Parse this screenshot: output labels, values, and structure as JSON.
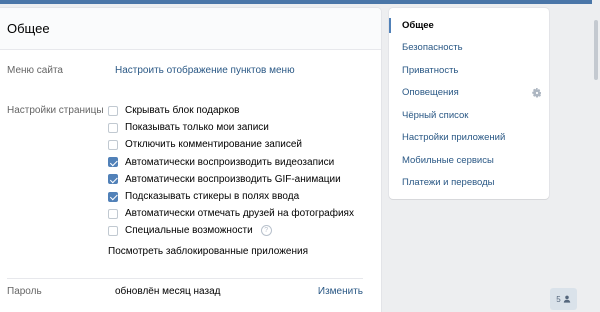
{
  "main": {
    "title": "Общее",
    "menu_row": {
      "label": "Меню сайта",
      "link": "Настроить отображение пунктов меню"
    },
    "page_settings": {
      "label": "Настройки страницы",
      "options": [
        {
          "label": "Скрывать блок подарков",
          "checked": false
        },
        {
          "label": "Показывать только мои записи",
          "checked": false
        },
        {
          "label": "Отключить комментирование записей",
          "checked": false
        },
        {
          "label": "Автоматически воспроизводить видеозаписи",
          "checked": true
        },
        {
          "label": "Автоматически воспроизводить GIF-анимации",
          "checked": true
        },
        {
          "label": "Подсказывать стикеры в полях ввода",
          "checked": true
        },
        {
          "label": "Автоматически отмечать друзей на фотографиях",
          "checked": false
        },
        {
          "label": "Специальные возможности",
          "checked": false
        }
      ],
      "help_glyph": "?",
      "blocked_apps_link": "Посмотреть заблокированные приложения"
    },
    "password_row": {
      "label": "Пароль",
      "value": "обновлён месяц назад",
      "action": "Изменить"
    }
  },
  "side_menu": {
    "items": [
      {
        "label": "Общее",
        "active": true
      },
      {
        "label": "Безопасность",
        "active": false
      },
      {
        "label": "Приватность",
        "active": false
      },
      {
        "label": "Оповещения",
        "active": false,
        "icon": "gear-icon"
      },
      {
        "label": "Чёрный список",
        "active": false
      },
      {
        "label": "Настройки приложений",
        "active": false
      },
      {
        "label": "Мобильные сервисы",
        "active": false
      },
      {
        "label": "Платежи и переводы",
        "active": false
      }
    ]
  },
  "counter": {
    "value": "5",
    "icon": "person-icon"
  },
  "colors": {
    "accent": "#5181b8",
    "link": "#2a5885",
    "background": "#edeef0"
  }
}
